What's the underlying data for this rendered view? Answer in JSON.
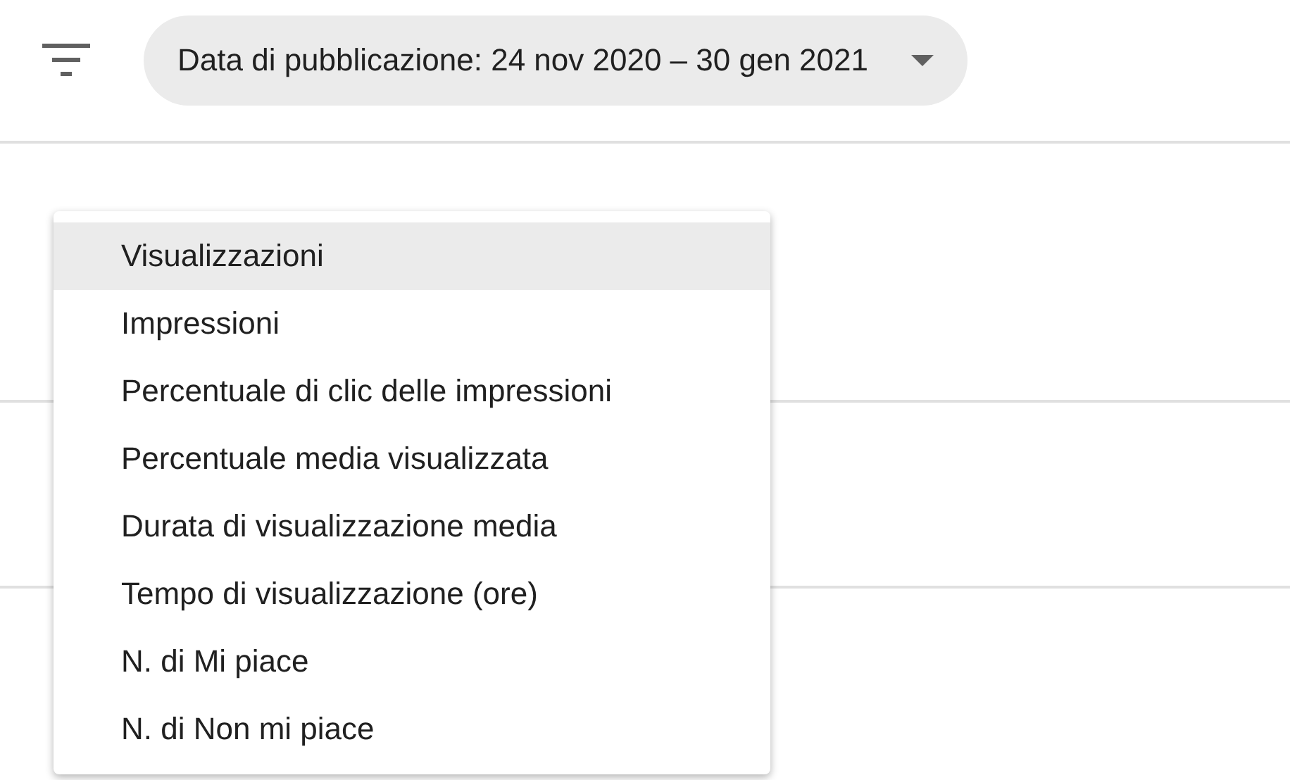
{
  "filter_chip": {
    "label": "Data di pubblicazione: 24 nov 2020 – 30 gen 2021"
  },
  "menu": {
    "items": [
      {
        "label": "Visualizzazioni",
        "selected": true
      },
      {
        "label": "Impressioni",
        "selected": false
      },
      {
        "label": "Percentuale di clic delle impressioni",
        "selected": false
      },
      {
        "label": "Percentuale media visualizzata",
        "selected": false
      },
      {
        "label": "Durata di visualizzazione media",
        "selected": false
      },
      {
        "label": "Tempo di visualizzazione (ore)",
        "selected": false
      },
      {
        "label": "N. di Mi piace",
        "selected": false
      },
      {
        "label": "N. di Non mi piace",
        "selected": false
      }
    ]
  }
}
